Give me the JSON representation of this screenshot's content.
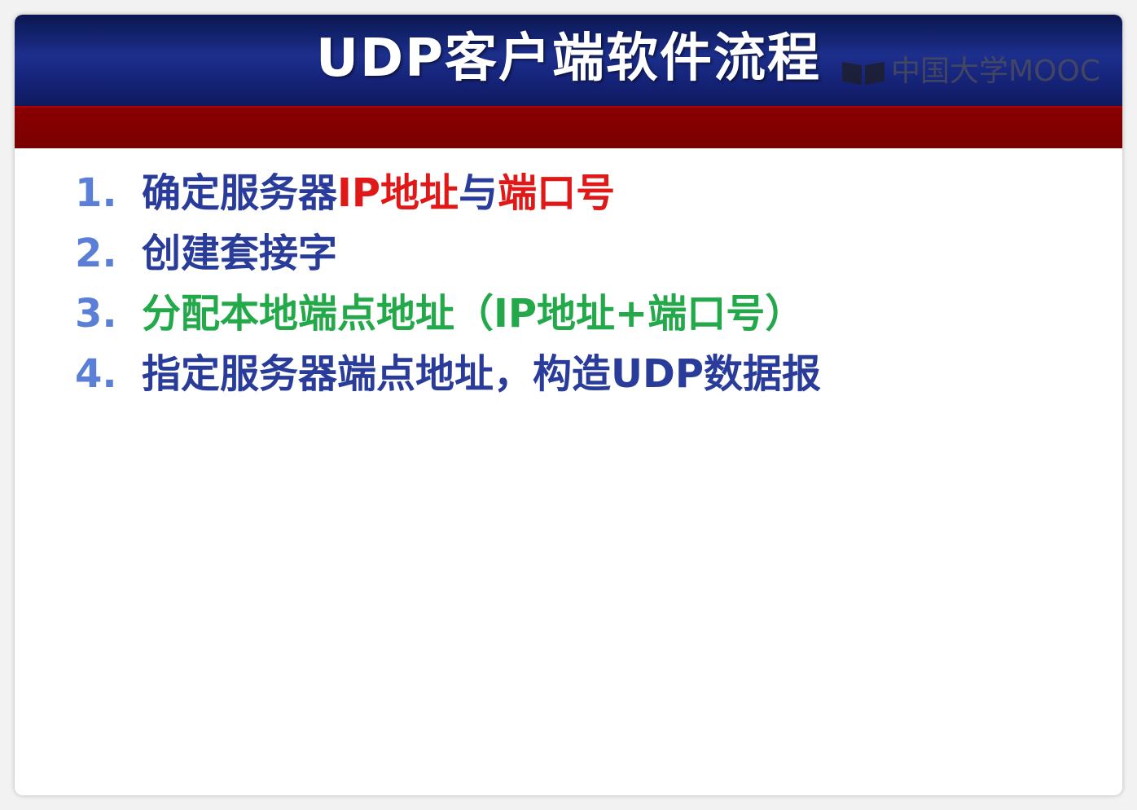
{
  "slide": {
    "title": "UDP客户端软件流程",
    "watermark": "中国大学MOOC",
    "watermark_icon": "mooc-book-icon",
    "colors": {
      "header": "#1c2f8c",
      "accent_bar": "#8a0000",
      "number": "#5b7fd6",
      "text": "#2a3c9a",
      "highlight_red": "#e01818",
      "highlight_green": "#23a84a"
    },
    "items": [
      {
        "number": "1.",
        "part1": "确定服务器",
        "part2": "IP地址",
        "part3": "与",
        "part4": "端口号"
      },
      {
        "number": "2.",
        "text": "创建套接字"
      },
      {
        "number": "3.",
        "text": "分配本地端点地址（IP地址+端口号）"
      },
      {
        "number": "4.",
        "text": "指定服务器端点地址，构造UDP数据报"
      }
    ]
  }
}
